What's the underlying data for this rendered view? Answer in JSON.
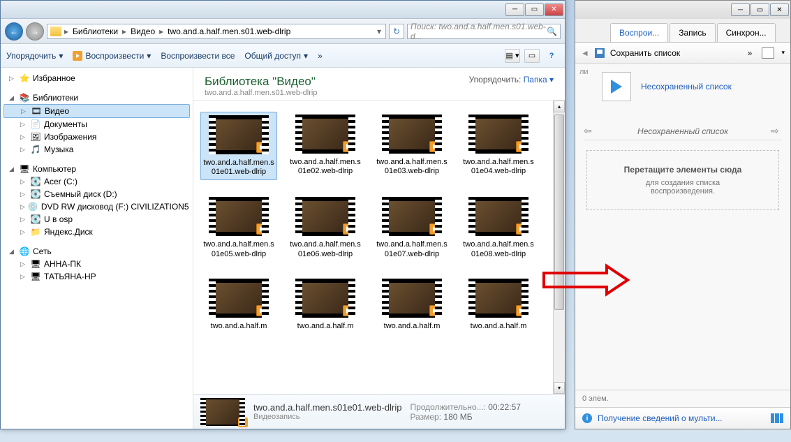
{
  "explorer": {
    "breadcrumb": [
      "Библиотеки",
      "Видео",
      "two.and.a.half.men.s01.web-dlrip"
    ],
    "search_placeholder": "Поиск: two.and.a.half.men.s01.web-d...",
    "toolbar": {
      "organize": "Упорядочить",
      "play": "Воспроизвести",
      "play_all": "Воспроизвести все",
      "share": "Общий доступ",
      "more": "»"
    },
    "tree": {
      "favorites": "Избранное",
      "libraries": "Библиотеки",
      "video": "Видео",
      "documents": "Документы",
      "pictures": "Изображения",
      "music": "Музыка",
      "computer": "Компьютер",
      "drives": [
        "Acer (C:)",
        "Съемный диск (D:)",
        "DVD RW дисковод (F:) CIVILIZATION5",
        "U в osp",
        "Яндекс.Диск"
      ],
      "network": "Сеть",
      "hosts": [
        "АННА-ПК",
        "ТАТЬЯНА-HP"
      ]
    },
    "library": {
      "title": "Библиотека \"Видео\"",
      "sub": "two.and.a.half.men.s01.web-dlrip",
      "sort_label": "Упорядочить:",
      "sort_value": "Папка"
    },
    "files": [
      "two.and.a.half.men.s01e01.web-dlrip",
      "two.and.a.half.men.s01e02.web-dlrip",
      "two.and.a.half.men.s01e03.web-dlrip",
      "two.and.a.half.men.s01e04.web-dlrip",
      "two.and.a.half.men.s01e05.web-dlrip",
      "two.and.a.half.men.s01e06.web-dlrip",
      "two.and.a.half.men.s01e07.web-dlrip",
      "two.and.a.half.men.s01e08.web-dlrip",
      "two.and.a.half.m",
      "two.and.a.half.m",
      "two.and.a.half.m",
      "two.and.a.half.m"
    ],
    "status": {
      "name": "two.and.a.half.men.s01e01.web-dlrip",
      "type": "Видеозапись",
      "duration_label": "Продолжительно...:",
      "duration": "00:22:57",
      "size_label": "Размер:",
      "size": "180 МБ"
    }
  },
  "player": {
    "tabs": [
      "Воспрои...",
      "Запись",
      "Синхрон..."
    ],
    "save_list": "Сохранить список",
    "unsaved_link": "Несохраненный список",
    "list_title": "Несохраненный список",
    "drop_big": "Перетащите элементы сюда",
    "drop_sm1": "для создания списка",
    "drop_sm2": "воспроизведения.",
    "items": "0 элем.",
    "info_link": "Получение сведений о мульти..."
  },
  "wmp_side_tab": "ли"
}
